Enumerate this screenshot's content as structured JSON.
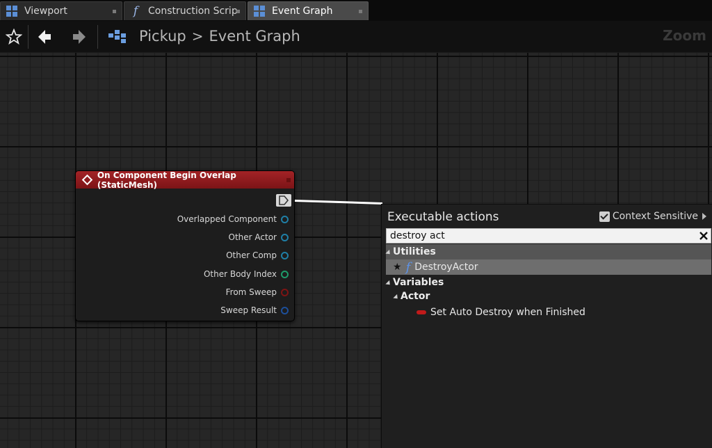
{
  "tabs": [
    {
      "label": "Viewport",
      "icon": "viewport-grid-icon",
      "active": false
    },
    {
      "label": "Construction Scrip",
      "icon": "function-icon",
      "active": false
    },
    {
      "label": "Event Graph",
      "icon": "event-graph-grid-icon",
      "active": true
    }
  ],
  "breadcrumb": {
    "root": "Pickup",
    "separator": ">",
    "current": "Event Graph"
  },
  "zoom_label": "Zoom",
  "node": {
    "title": "On Component Begin Overlap (StaticMesh)",
    "pins": [
      {
        "label": "Overlapped Component",
        "color": "#1f7fa6"
      },
      {
        "label": "Other Actor",
        "color": "#1f7fa6"
      },
      {
        "label": "Other Comp",
        "color": "#1f7fa6"
      },
      {
        "label": "Other Body Index",
        "color": "#1e9b6a"
      },
      {
        "label": "From Sweep",
        "color": "#7d1414"
      },
      {
        "label": "Sweep Result",
        "color": "#1d4f9a"
      }
    ]
  },
  "menu": {
    "title": "Executable actions",
    "context_sensitive_label": "Context Sensitive",
    "context_sensitive_checked": true,
    "search_value": "destroy act",
    "categories": {
      "utilities": "Utilities",
      "variables": "Variables",
      "actor": "Actor"
    },
    "items": {
      "destroy_actor": "DestroyActor",
      "set_auto_destroy": "Set Auto Destroy when Finished"
    }
  },
  "colors": {
    "node_header": "#a32326",
    "selection": "#6e6e6e",
    "function_blue": "#5d93e8"
  }
}
